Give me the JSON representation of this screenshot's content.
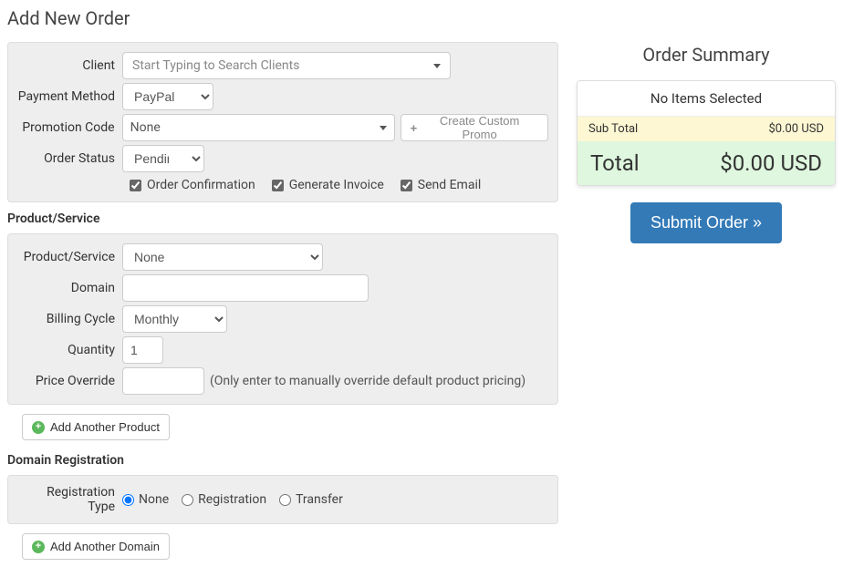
{
  "page_title": "Add New Order",
  "order": {
    "client_label": "Client",
    "client_placeholder": "Start Typing to Search Clients",
    "payment_method_label": "Payment Method",
    "payment_method_value": "PayPal",
    "promotion_code_label": "Promotion Code",
    "promotion_code_value": "None",
    "create_promo_label": "Create Custom Promo",
    "order_status_label": "Order Status",
    "order_status_value": "Pending",
    "order_confirmation_label": "Order Confirmation",
    "generate_invoice_label": "Generate Invoice",
    "send_email_label": "Send Email"
  },
  "product_section": {
    "heading": "Product/Service",
    "product_service_label": "Product/Service",
    "product_service_value": "None",
    "domain_label": "Domain",
    "domain_value": "",
    "billing_cycle_label": "Billing Cycle",
    "billing_cycle_value": "Monthly",
    "quantity_label": "Quantity",
    "quantity_value": "1",
    "price_override_label": "Price Override",
    "price_override_value": "",
    "price_override_hint": "(Only enter to manually override default product pricing)",
    "add_another_product_label": "Add Another Product"
  },
  "domain_section": {
    "heading": "Domain Registration",
    "registration_type_label": "Registration Type",
    "option_none": "None",
    "option_registration": "Registration",
    "option_transfer": "Transfer",
    "add_another_domain_label": "Add Another Domain"
  },
  "summary": {
    "title": "Order Summary",
    "no_items": "No Items Selected",
    "subtotal_label": "Sub Total",
    "subtotal_value": "$0.00 USD",
    "total_label": "Total",
    "total_value": "$0.00 USD",
    "submit_label": "Submit Order »"
  }
}
